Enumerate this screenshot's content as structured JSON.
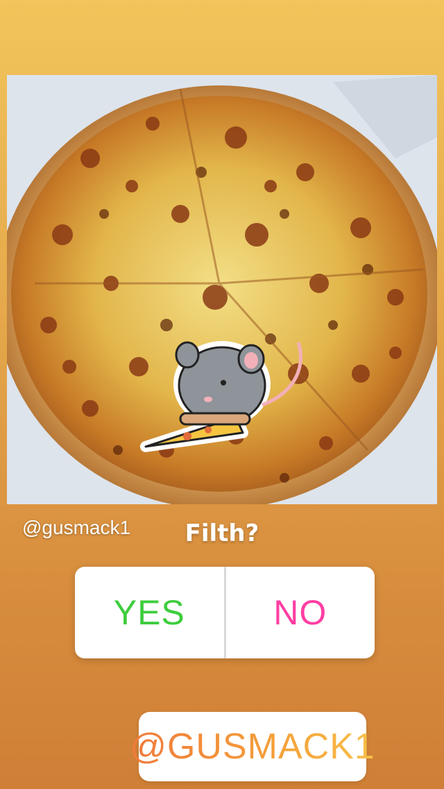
{
  "story": {
    "handle": "@gusmack1",
    "photo_icon": "pizza-photo",
    "sticker_icon": "mouse-with-pizza-sticker"
  },
  "poll": {
    "question": "Filth?",
    "options": [
      {
        "label": "YES",
        "color": "#3dcd3d"
      },
      {
        "label": "NO",
        "color": "#ff3fa4"
      }
    ]
  },
  "mention": {
    "text": "@GUSMACK1"
  }
}
